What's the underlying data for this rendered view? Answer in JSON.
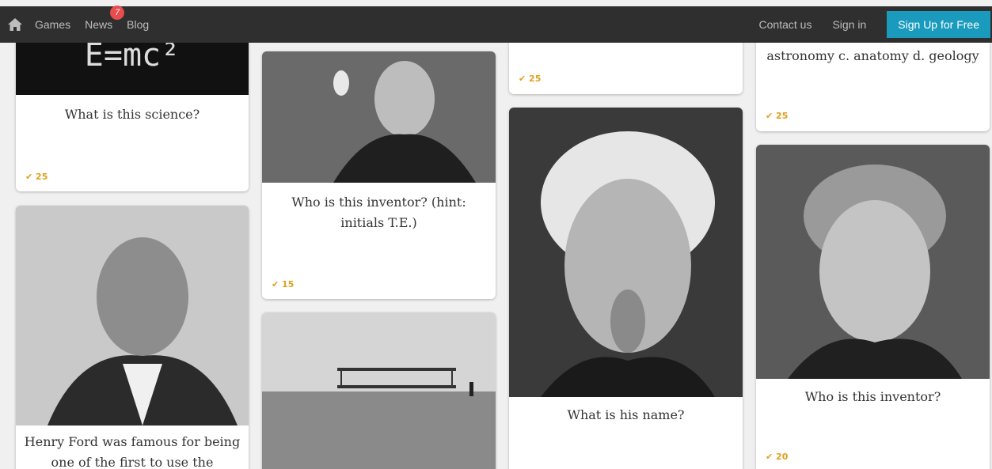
{
  "nav": {
    "games": "Games",
    "news": "News",
    "news_badge": "7",
    "blog": "Blog",
    "contact": "Contact us",
    "signin": "Sign in",
    "signup": "Sign Up for Free"
  },
  "cards": [
    {
      "id": "science",
      "question": "What is this science?",
      "points": "✔ 25",
      "image_text": "E=mc²"
    },
    {
      "id": "henry-ford",
      "question": "Henry Ford was famous for being one of the first to use the"
    },
    {
      "id": "edison",
      "question": "Who is this inventor? (hint: initials T.E.)",
      "points": "✔ 15"
    },
    {
      "id": "wright",
      "question": ""
    },
    {
      "id": "top-col3",
      "points": "✔ 25"
    },
    {
      "id": "einstein",
      "question": "What is his name?"
    },
    {
      "id": "geology",
      "question": "astronomy c. anatomy d. geology",
      "points": "✔ 25"
    },
    {
      "id": "curie",
      "question": "Who is this inventor?",
      "points": "✔ 20"
    }
  ],
  "colors": {
    "accent": "#1a9bbd",
    "points": "#e0a020",
    "badge": "#e84c4c",
    "topbar": "#2f2f2f"
  },
  "icons": {
    "home": "home-icon",
    "check": "check-icon"
  }
}
